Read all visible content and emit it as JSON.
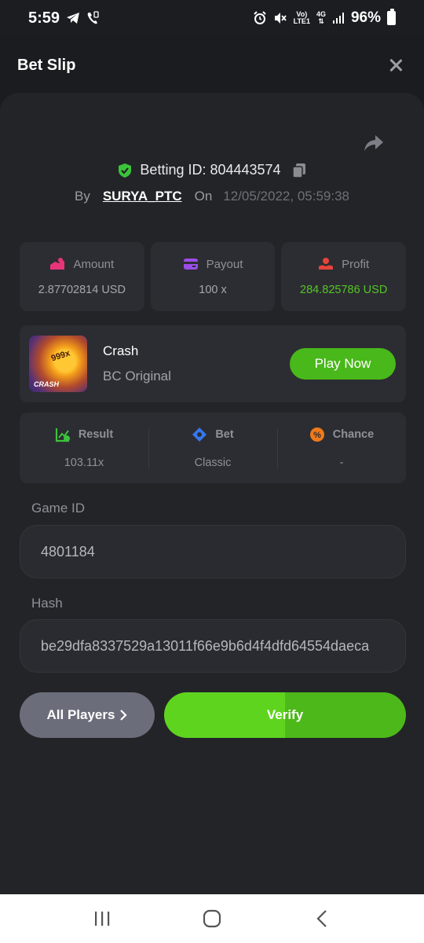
{
  "status_bar": {
    "time": "5:59",
    "network_label_top": "Vo)",
    "network_label_bottom": "LTE1",
    "gen_label": "4G",
    "battery": "96%"
  },
  "header": {
    "title": "Bet Slip"
  },
  "bet": {
    "betting_id_label": "Betting ID: 804443574",
    "by_label": "By",
    "username": "SURYA_PTC",
    "on_label": "On",
    "datetime": "12/05/2022, 05:59:38"
  },
  "stats": [
    {
      "label": "Amount",
      "value": "2.87702814 USD",
      "icon": "amount-icon",
      "color": "#e8357a"
    },
    {
      "label": "Payout",
      "value": "100 x",
      "icon": "payout-icon",
      "color": "#9b4de8"
    },
    {
      "label": "Profit",
      "value": "284.825786 USD",
      "icon": "profit-icon",
      "color": "#e8443a"
    }
  ],
  "game": {
    "name": "Crash",
    "provider": "BC Original",
    "thumb_multiplier": "999x",
    "thumb_title": "CRASH",
    "play_label": "Play Now"
  },
  "details": [
    {
      "label": "Result",
      "value": "103.11x",
      "icon": "result-icon"
    },
    {
      "label": "Bet",
      "value": "Classic",
      "icon": "bet-icon"
    },
    {
      "label": "Chance",
      "value": "-",
      "icon": "chance-icon"
    }
  ],
  "game_id": {
    "label": "Game ID",
    "value": "4801184"
  },
  "hash": {
    "label": "Hash",
    "value": "be29dfa8337529a13011f66e9b6d4f4dfd64554daeca"
  },
  "buttons": {
    "all_players": "All Players",
    "verify": "Verify"
  },
  "colors": {
    "accent_green": "#49b81a",
    "profit_green": "#55c524",
    "background": "#1b1c1f",
    "card": "#232428"
  }
}
